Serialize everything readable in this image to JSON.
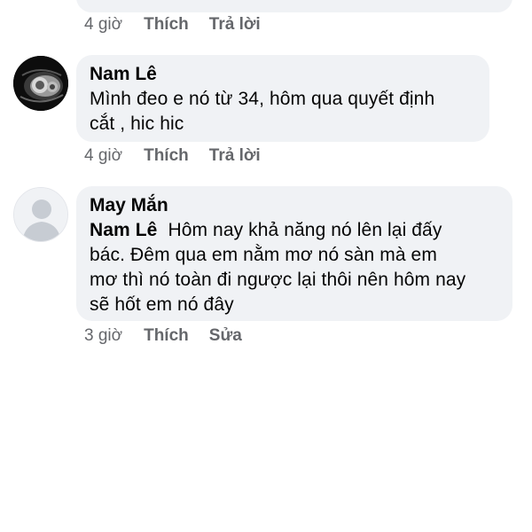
{
  "previous_comment": {
    "time": "4 giờ",
    "like_label": "Thích",
    "reply_label": "Trả lời"
  },
  "comment_1": {
    "author": "Nam Lê",
    "lines": [
      "Mình đeo e nó từ 34, hôm qua quyết định",
      "cắt , hic hic"
    ],
    "time": "4 giờ",
    "like_label": "Thích",
    "reply_label": "Trả lời",
    "avatar_icon": "car-headlight-avatar"
  },
  "comment_2": {
    "author": "May Mắn",
    "mention": "Nam Lê",
    "lines": [
      "Hôm nay khả năng nó lên lại đấy",
      "bác. Đêm qua em nằm mơ nó sàn mà em",
      "mơ thì nó toàn đi ngược lại thôi nên hôm nay",
      "sẽ hốt em nó đây"
    ],
    "time": "3 giờ",
    "like_label": "Thích",
    "edit_label": "Sửa",
    "avatar_icon": "default-user-avatar"
  },
  "colors": {
    "bubble_bg": "#f0f2f5",
    "meta_text": "#65676b",
    "primary_text": "#050505"
  }
}
